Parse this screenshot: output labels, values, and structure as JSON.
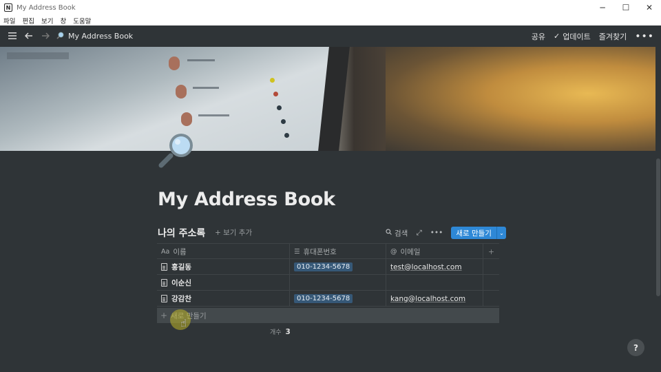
{
  "window": {
    "title": "My Address Book",
    "logo_letter": "N",
    "controls": {
      "minimize": "−",
      "maximize": "☐",
      "close": "✕"
    }
  },
  "menu": [
    "파일",
    "편집",
    "보기",
    "창",
    "도움말"
  ],
  "toolbar": {
    "breadcrumb": "My Address Book",
    "share": "공유",
    "updates_check": "✓",
    "updates": "업데이트",
    "favorites": "즐겨찾기",
    "more": "•••",
    "icons": {
      "menu": "hamburger-icon",
      "back": "arrow-left-icon",
      "forward": "arrow-right-icon",
      "page": "magnifier-icon"
    }
  },
  "page": {
    "title": "My Address Book",
    "icon": "magnifier-icon"
  },
  "database": {
    "title": "나의 주소록",
    "add_view": "+ 보기 추가",
    "search": "검색",
    "expand_icon": "⤢",
    "more_icon": "•••",
    "new_button": "새로 만들기",
    "new_button_arrow": "⌄",
    "columns": [
      {
        "icon": "Aa",
        "label": "이름"
      },
      {
        "icon": "☰",
        "label": "휴대폰번호"
      },
      {
        "icon": "@",
        "label": "이메일"
      }
    ],
    "add_column": "+",
    "rows": [
      {
        "name": "홍길동",
        "phone": "010-1234-5678",
        "email": "test@localhost.com"
      },
      {
        "name": "이순신",
        "phone": "",
        "email": ""
      },
      {
        "name": "강감찬",
        "phone": "010-1234-5678",
        "email": "kang@localhost.com"
      }
    ],
    "new_row_plus": "+",
    "new_row": "새로 만들기",
    "count_label": "개수",
    "count_value": "3"
  },
  "help": "?",
  "colors": {
    "accent": "#2e88d6",
    "background": "#2f3437",
    "phone_tag": "#365877"
  }
}
